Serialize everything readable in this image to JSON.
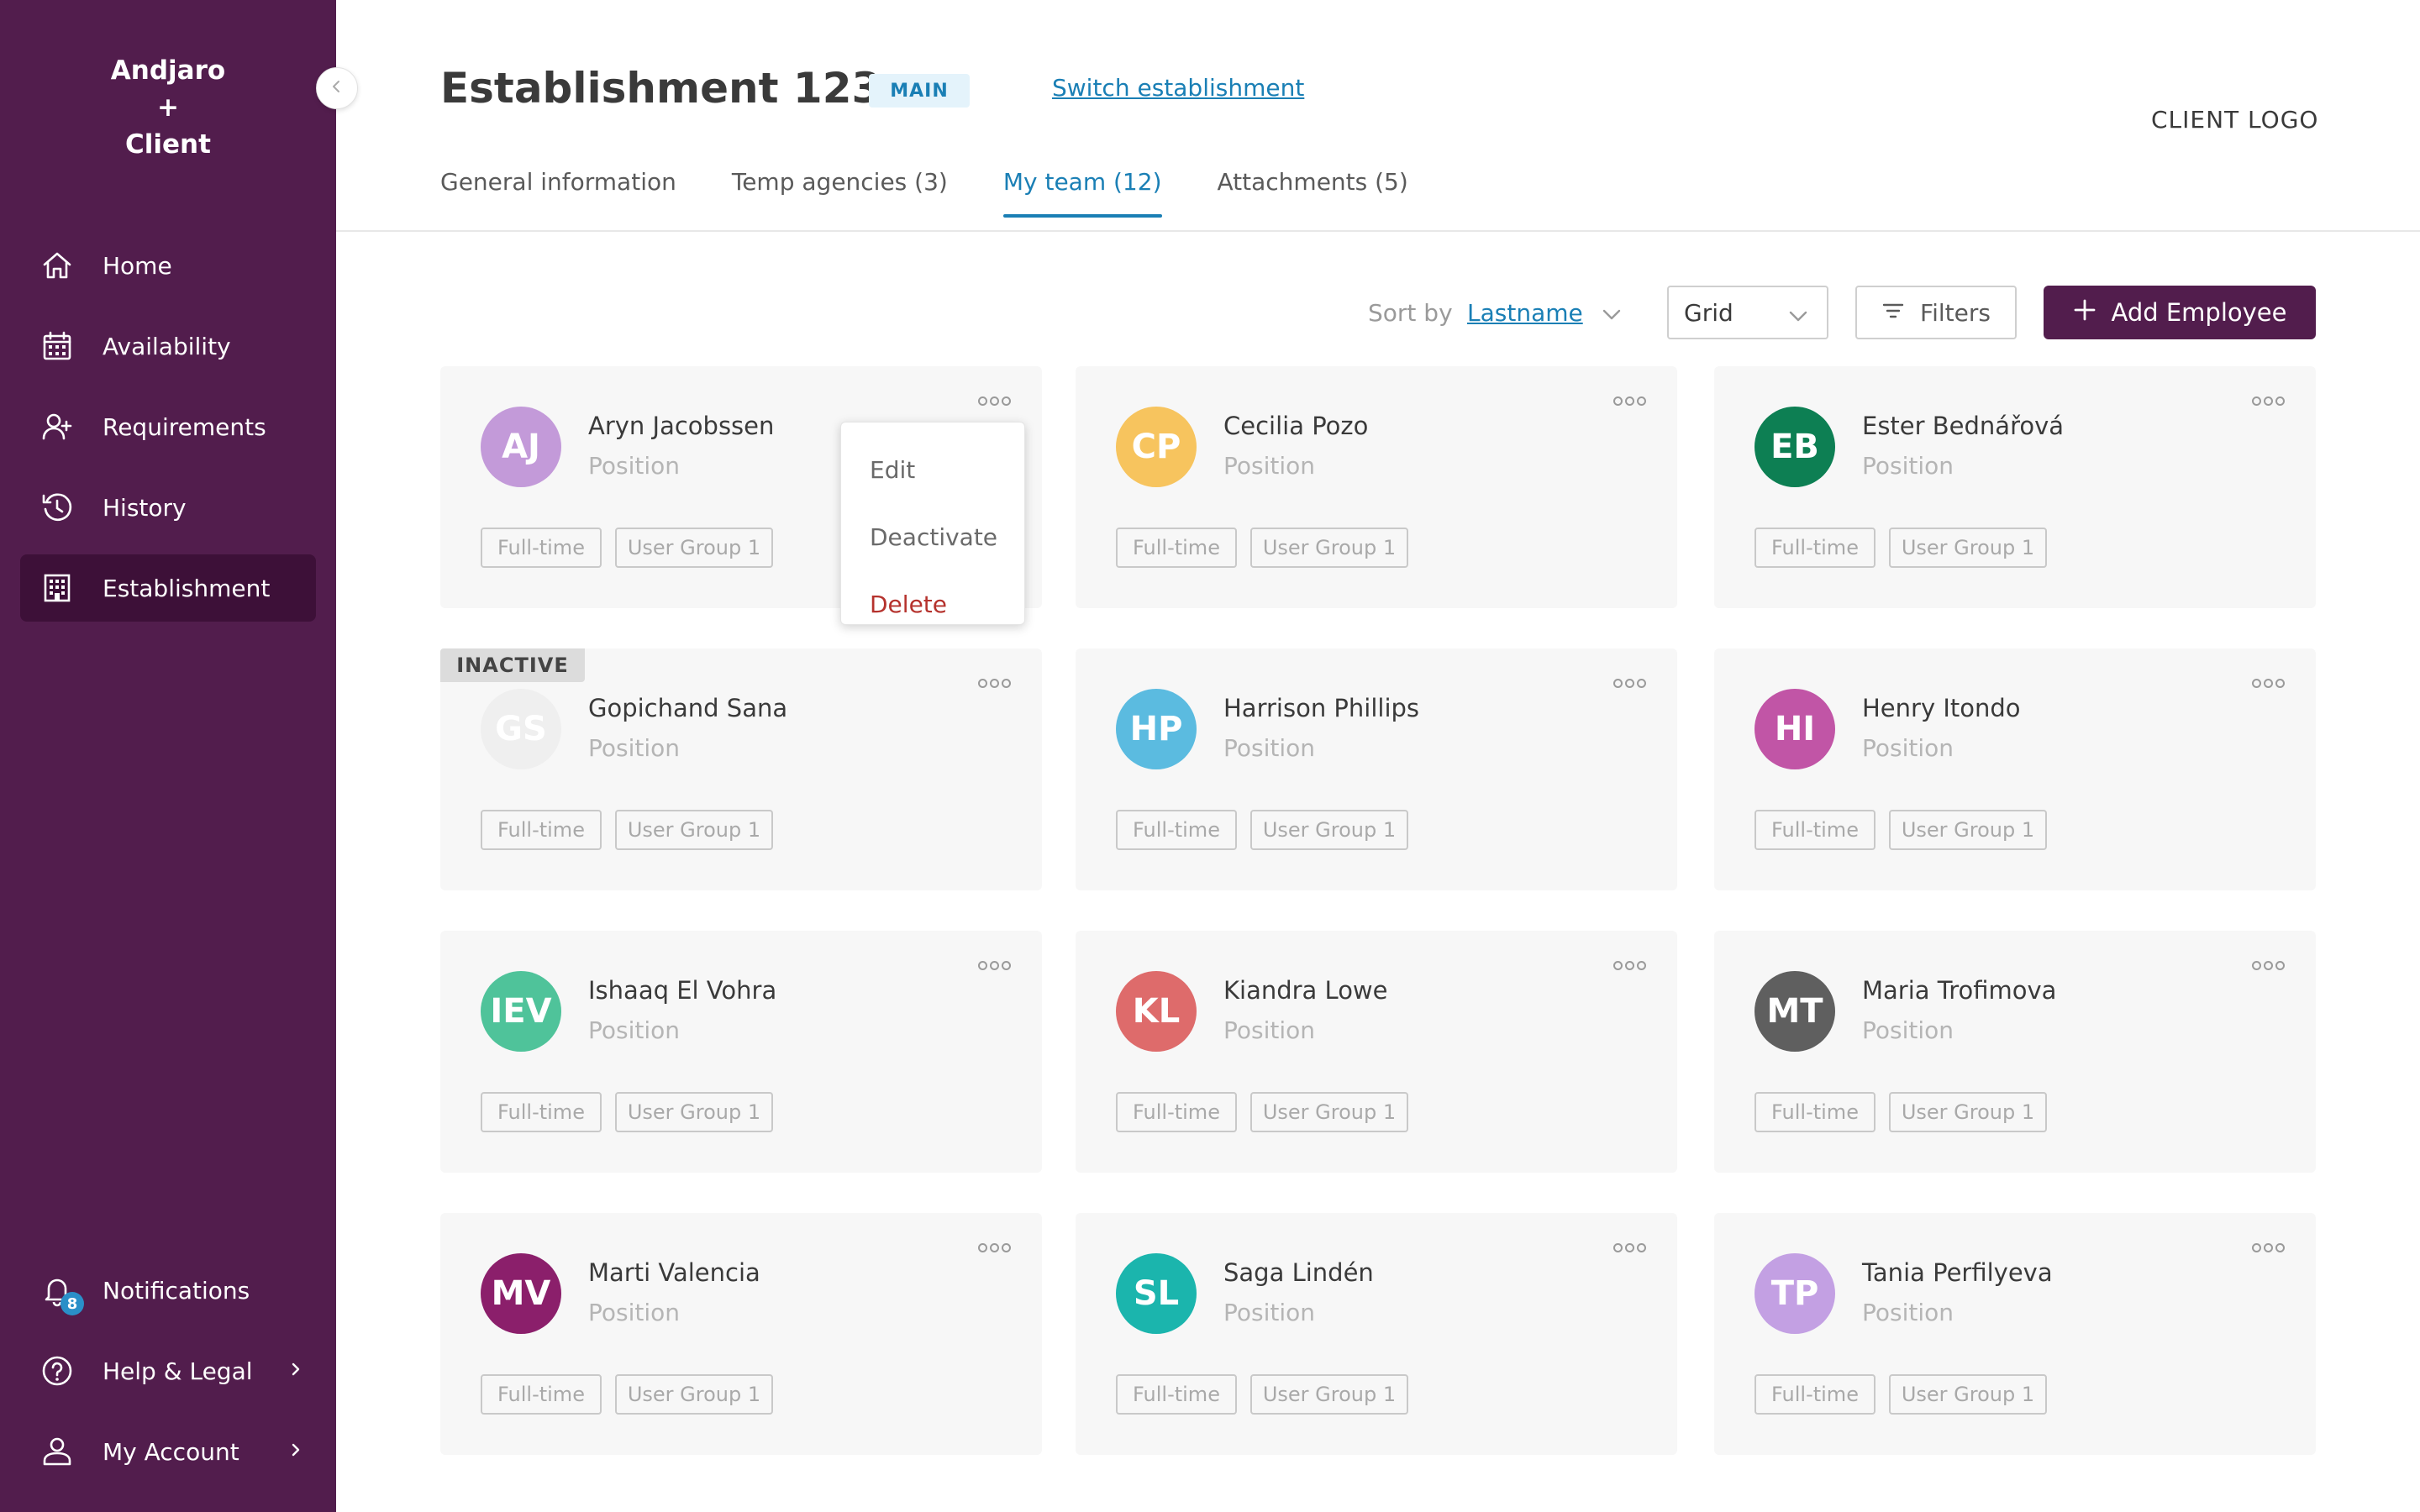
{
  "sidebar": {
    "brand_line1": "Andjaro",
    "brand_line2": "+",
    "brand_line3": "Client",
    "items": [
      {
        "label": "Home",
        "icon": "home-icon"
      },
      {
        "label": "Availability",
        "icon": "calendar-icon"
      },
      {
        "label": "Requirements",
        "icon": "add-user-icon"
      },
      {
        "label": "History",
        "icon": "history-icon"
      },
      {
        "label": "Establishment",
        "icon": "building-icon",
        "active": true
      }
    ],
    "bottom_items": [
      {
        "label": "Notifications",
        "icon": "bell-icon",
        "badge": "8"
      },
      {
        "label": "Help & Legal",
        "icon": "help-icon"
      },
      {
        "label": "My Account",
        "icon": "user-icon"
      }
    ]
  },
  "header": {
    "title": "Establishment 123",
    "badge": "MAIN",
    "switch_link": "Switch establishment",
    "client_logo": "CLIENT LOGO"
  },
  "tabs": [
    {
      "label": "General information"
    },
    {
      "label": "Temp agencies (3)"
    },
    {
      "label": "My team (12)",
      "active": true
    },
    {
      "label": "Attachments (5)"
    }
  ],
  "toolbar": {
    "sort_label": "Sort by",
    "sort_value": "Lastname",
    "view_select": "Grid",
    "filters_label": "Filters",
    "add_label": "Add Employee"
  },
  "context_menu": {
    "edit": "Edit",
    "deactivate": "Deactivate",
    "delete": "Delete"
  },
  "employees": [
    {
      "initials": "AJ",
      "name": "Aryn Jacobssen",
      "position": "Position",
      "contract": "Full-time",
      "group": "User Group 1",
      "color": "#c39ad9"
    },
    {
      "initials": "CP",
      "name": "Cecilia Pozo",
      "position": "Position",
      "contract": "Full-time",
      "group": "User Group 1",
      "color": "#f7c45e"
    },
    {
      "initials": "EB",
      "name": "Ester Bednářová",
      "position": "Position",
      "contract": "Full-time",
      "group": "User Group 1",
      "color": "#0d7f53"
    },
    {
      "initials": "GS",
      "name": "Gopichand Sana",
      "position": "Position",
      "contract": "Full-time",
      "group": "User Group 1",
      "color": "#efefef",
      "inactive": "INACTIVE"
    },
    {
      "initials": "HP",
      "name": "Harrison Phillips",
      "position": "Position",
      "contract": "Full-time",
      "group": "User Group 1",
      "color": "#5bbbe0"
    },
    {
      "initials": "HI",
      "name": "Henry Itondo",
      "position": "Position",
      "contract": "Full-time",
      "group": "User Group 1",
      "color": "#c155a6"
    },
    {
      "initials": "IEV",
      "name": "Ishaaq El Vohra",
      "position": "Position",
      "contract": "Full-time",
      "group": "User Group 1",
      "color": "#4fc39a"
    },
    {
      "initials": "KL",
      "name": "Kiandra Lowe",
      "position": "Position",
      "contract": "Full-time",
      "group": "User Group 1",
      "color": "#de6b6b"
    },
    {
      "initials": "MT",
      "name": "Maria Trofimova",
      "position": "Position",
      "contract": "Full-time",
      "group": "User Group 1",
      "color": "#5f5f5f"
    },
    {
      "initials": "MV",
      "name": "Marti Valencia",
      "position": "Position",
      "contract": "Full-time",
      "group": "User Group 1",
      "color": "#8b1f6b"
    },
    {
      "initials": "SL",
      "name": "Saga Lindén",
      "position": "Position",
      "contract": "Full-time",
      "group": "User Group 1",
      "color": "#1bb5ad"
    },
    {
      "initials": "TP",
      "name": "Tania Perfilyeva",
      "position": "Position",
      "contract": "Full-time",
      "group": "User Group 1",
      "color": "#c3a0e3"
    }
  ]
}
